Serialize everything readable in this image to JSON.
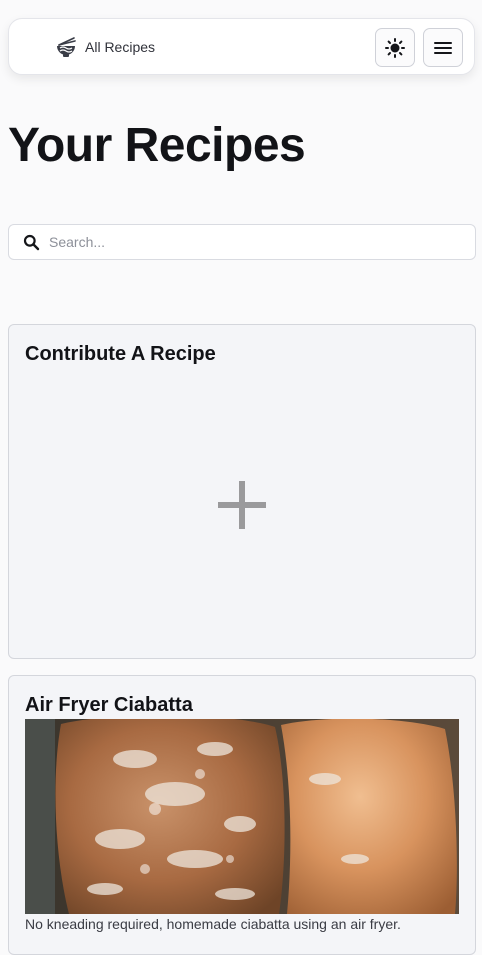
{
  "nav": {
    "brand_label": "All Recipes",
    "brand_icon": "noodle-bowl-icon",
    "theme_icon": "sun-icon",
    "menu_icon": "hamburger-menu-icon"
  },
  "page": {
    "title": "Your Recipes"
  },
  "search": {
    "placeholder": "Search...",
    "value": ""
  },
  "cards": {
    "contribute": {
      "title": "Contribute A Recipe",
      "icon": "plus-icon"
    },
    "recipes": [
      {
        "title": "Air Fryer Ciabatta",
        "description": "No kneading required, homemade ciabatta using an air fryer."
      }
    ]
  },
  "colors": {
    "background": "#fafafb",
    "card_background": "#f4f5f8",
    "border": "#d4d6dc",
    "plus": "#9a9a9c",
    "text": "#121317"
  }
}
